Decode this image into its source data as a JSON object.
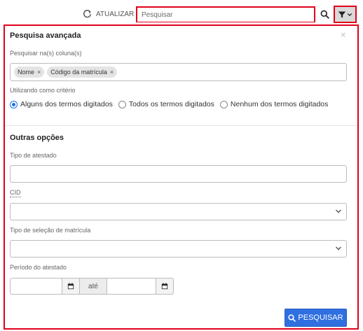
{
  "toolbar": {
    "refresh_label": "ATUALIZAR",
    "search_placeholder": "Pesquisar",
    "search_value": ""
  },
  "icons": {
    "refresh": "refresh-icon",
    "search": "search-icon",
    "filter": "filter-icon",
    "close": "close-icon",
    "calendar": "calendar-icon",
    "chevron": "chevron-down-icon"
  },
  "colors": {
    "highlight_border": "#e0001b",
    "primary": "#2f6fe0",
    "radio_active": "#1a73e8"
  },
  "panel": {
    "close_glyph": "×",
    "advanced": {
      "title": "Pesquisa avançada",
      "columns_label": "Pesquisar na(s) coluna(s)",
      "tags": [
        {
          "label": "Nome",
          "remove": "×"
        },
        {
          "label": "Código da matrícula",
          "remove": "×"
        }
      ],
      "criteria_label": "Utilizando como critério",
      "criteria_options": [
        {
          "label": "Alguns dos termos digitados",
          "selected": true
        },
        {
          "label": "Todos os termos digitados",
          "selected": false
        },
        {
          "label": "Nenhum dos termos digitados",
          "selected": false
        }
      ]
    },
    "other": {
      "title": "Outras opções",
      "tipo_atestado_label": "Tipo de atestado",
      "tipo_atestado_value": "",
      "cid_label": "CID",
      "cid_value": "",
      "tipo_selecao_label": "Tipo de seleção de matrícula",
      "tipo_selecao_value": "",
      "periodo_label": "Período do atestado",
      "periodo_from": "",
      "periodo_to": "",
      "ate_label": "até"
    },
    "submit_label": "PESQUISAR"
  }
}
